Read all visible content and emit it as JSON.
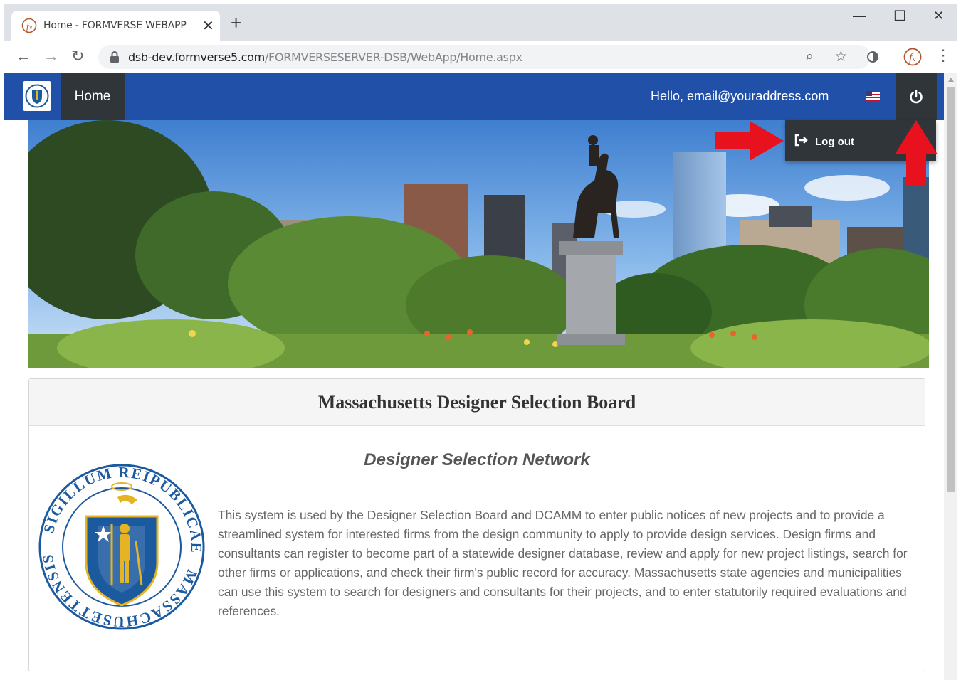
{
  "browser": {
    "tab_title": "Home - FORMVERSE WEBAPP",
    "tab_close": "✕",
    "new_tab": "+",
    "url_domain": "dsb-dev.formverse5.com",
    "url_path": "/FORMVERSESERVER-DSB/WebApp/Home.aspx",
    "minimize": "—",
    "maximize": "☐",
    "close": "✕",
    "back": "←",
    "forward": "→",
    "reload": "↻",
    "zoom_icon": "⌕",
    "bookmark_icon": "☆",
    "menu_icon": "⋮"
  },
  "navbar": {
    "home_label": "Home",
    "greeting": "Hello, email@youraddress.com",
    "logout_label": "Log out",
    "color": "#2150a8"
  },
  "card": {
    "title": "Massachusetts Designer Selection Board",
    "subtitle": "Designer Selection Network",
    "description": "This system is used by the Designer Selection Board and DCAMM to enter public notices of new projects and to provide a streamlined system for interested firms from the design community to apply to provide design services. Design firms and consultants can register to become part of a statewide designer database, review and apply for new project listings, search for other firms or applications, and check their firm's public record for accuracy. Massachusetts state agencies and municipalities can use this system to search for designers and consultants for their projects, and to enter statutorily required evaluations and references."
  },
  "seal": {
    "text_top": "SIGILLUM REIPUBLICAE",
    "text_bottom": "MASSACHUSETTENSIS",
    "color": "#1c5aa0"
  }
}
